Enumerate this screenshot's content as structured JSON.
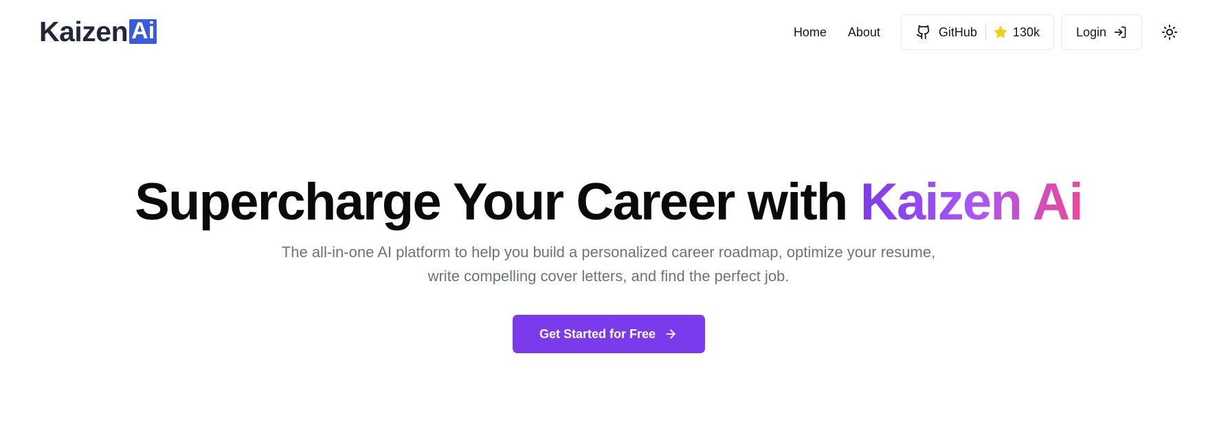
{
  "header": {
    "logo": {
      "text": "Kaizen",
      "badge": "Ai"
    },
    "nav": [
      {
        "label": "Home"
      },
      {
        "label": "About"
      }
    ],
    "github": {
      "label": "GitHub",
      "stars": "130k",
      "icon": "github-icon",
      "star_icon": "star-icon",
      "star_color": "#facc15"
    },
    "login": {
      "label": "Login",
      "icon": "login-icon"
    },
    "theme_toggle": {
      "icon": "sun-icon"
    }
  },
  "hero": {
    "headline_prefix": "Supercharge Your Career with",
    "headline_brand": "Kaizen Ai",
    "subtitle": "The all-in-one AI platform to help you build a personalized career roadmap, optimize your resume, write compelling cover letters, and find the perfect job.",
    "cta": {
      "label": "Get Started for Free",
      "icon": "arrow-right-icon"
    }
  },
  "colors": {
    "accent": "#7c3aed",
    "brand_gradient": [
      "#7c3aed",
      "#a855f7",
      "#ec4899"
    ],
    "logo_badge": "#3b5bdb",
    "subtitle_text": "#6b7280"
  }
}
